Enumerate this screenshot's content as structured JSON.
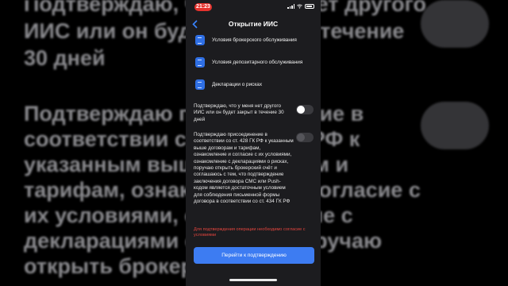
{
  "background": {
    "lines": [
      "Подтверждаю, что у меня нет другого",
      "ИИС или он будет закрыт в течение",
      "30 дней",
      "Подтверждаю присоединение в",
      "соответствии со ст. 428 ГК РФ к",
      "указанным выше договорам и",
      "тарифам, ознакомление и согласие с",
      "их условиями, ознакомление с",
      "декларациями о рисках, поручаю",
      "открыть брокерский счёт и"
    ]
  },
  "status_bar": {
    "time": "21:23"
  },
  "nav": {
    "back_icon": "chevron-left-icon",
    "title": "Открытие ИИС"
  },
  "documents": [
    {
      "label": "Условия брокерского обслуживания",
      "icon": "document-icon"
    },
    {
      "label": "Условия депозитарного обслуживания",
      "icon": "document-icon"
    },
    {
      "label": "Декларации о рисках",
      "icon": "document-icon"
    }
  ],
  "consents": [
    {
      "text": "Подтверждаю, что у меня нет другого ИИС или он будет закрыт в течение 30 дней",
      "checked": false
    },
    {
      "text": "Подтверждаю присоединение в соответствии со ст. 428 ГК РФ к указанным выше договорам и тарифам, ознакомление и согласие с их условиями, ознакомление с декларациями о рисках, поручаю открыть брокерский счёт и соглашаюсь с тем, что подтверждение заключения договора СМС или Push-кодом является достаточным условием для соблюдения письменной формы договора в соответствии со ст. 434 ГК РФ",
      "checked": false
    }
  ],
  "warning": "Для подтверждения операции необходимо согласие с условиями",
  "cta_label": "Перейти к подтверждению",
  "colors": {
    "accent": "#3d7cf2",
    "error": "#e3453e",
    "time_pill": "#e5322d"
  }
}
